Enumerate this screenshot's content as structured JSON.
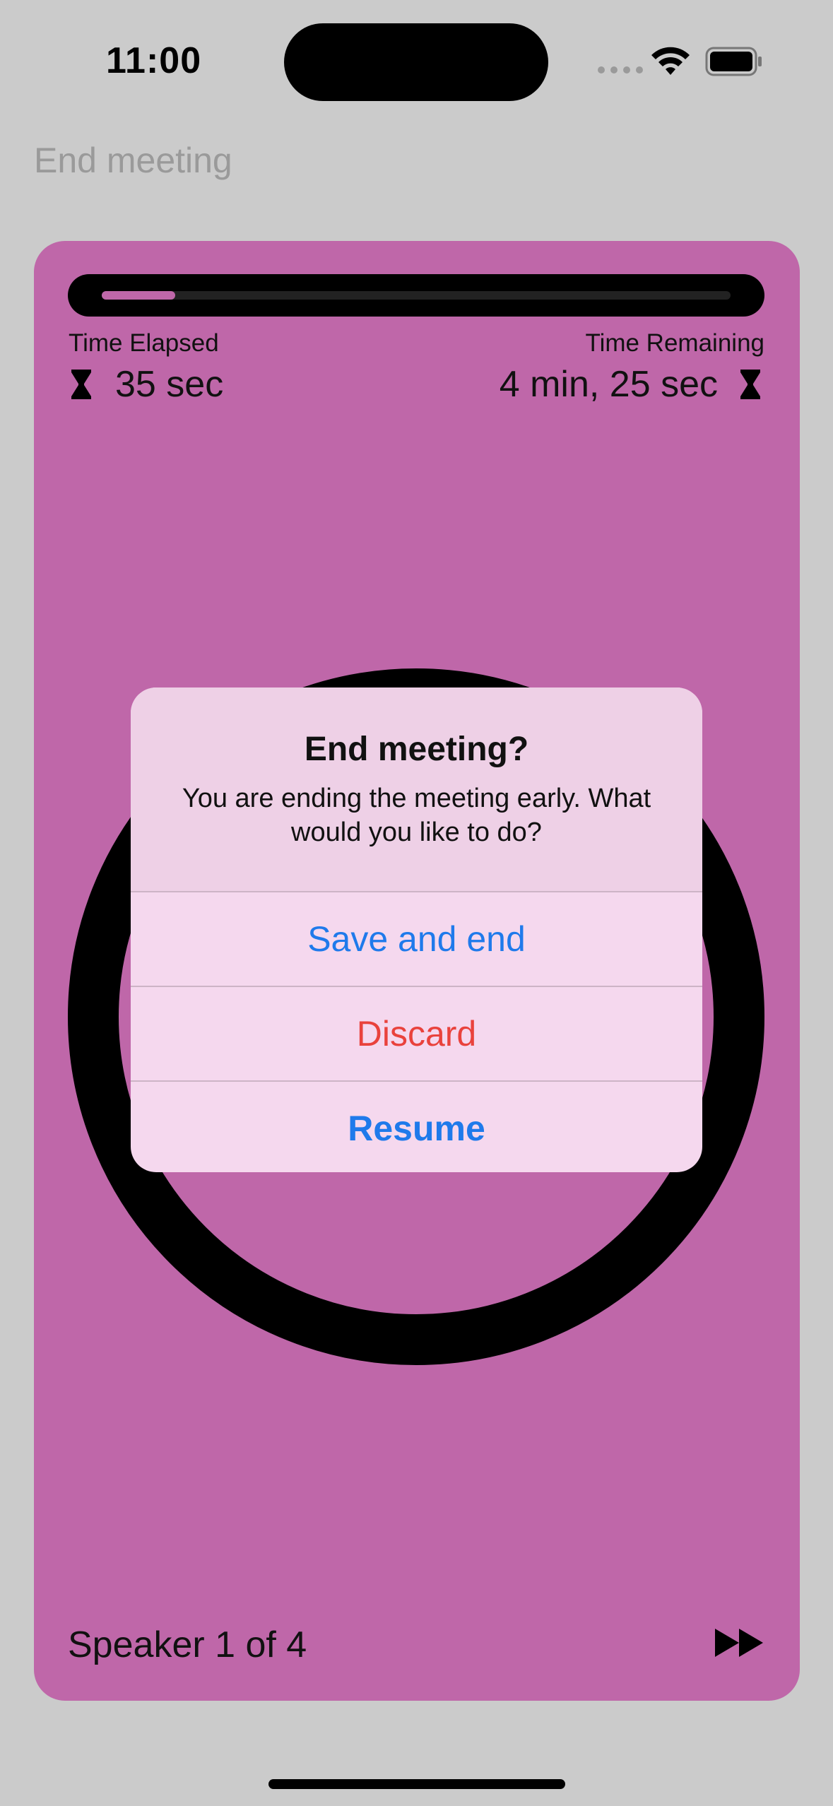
{
  "status_bar": {
    "time": "11:00",
    "icons": [
      "signal-icon",
      "wifi-icon",
      "battery-icon"
    ]
  },
  "nav": {
    "back_label": "End meeting"
  },
  "meeting": {
    "progress_fraction": 0.117,
    "time_elapsed_label": "Time Elapsed",
    "time_elapsed_value": "35 sec",
    "time_remaining_label": "Time Remaining",
    "time_remaining_value": "4 min, 25 sec",
    "speaker_label": "Speaker 1 of 4",
    "skip_icon": "forward-icon"
  },
  "alert": {
    "title": "End meeting?",
    "message": "You are ending the meeting early. What would you like to do?",
    "actions": [
      {
        "label": "Save and end",
        "color": "#1f7aeb"
      },
      {
        "label": "Discard",
        "color": "#e9423c"
      },
      {
        "label": "Resume",
        "color": "#1f7aeb"
      }
    ]
  },
  "colors": {
    "theme": "#bf67a9",
    "background": "#cbcbcb"
  }
}
